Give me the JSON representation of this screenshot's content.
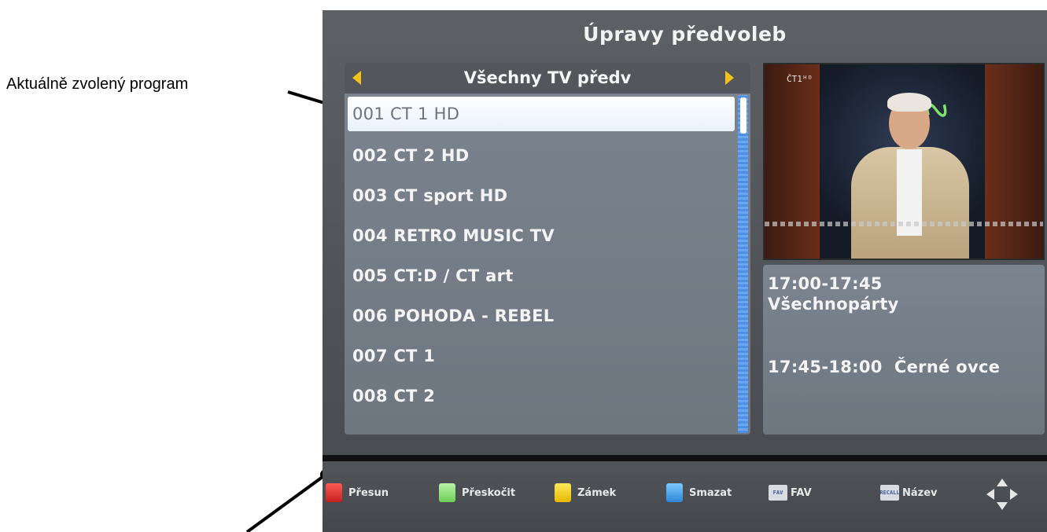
{
  "annotation": {
    "label": "Aktuálně zvolený program"
  },
  "screen": {
    "title": "Úpravy předvoleb",
    "list": {
      "header": "Všechny TV předv",
      "channels": [
        "001 CT 1 HD",
        "002 CT 2 HD",
        "003 CT sport HD",
        "004 RETRO MUSIC TV",
        "005 CT:D / CT art",
        "006 POHODA - REBEL",
        "007 CT 1",
        "008 CT 2"
      ],
      "selected_index": 0
    },
    "preview": {
      "logo": "ČT1ᴴᴰ"
    },
    "epg": {
      "now_time": "17:00-17:45",
      "now_title": "Všechnopárty",
      "next": "17:45-18:00  Černé ovce"
    },
    "footer": {
      "keys": [
        {
          "label": "Přesun",
          "color": "#e0302e"
        },
        {
          "label": "Přeskočit",
          "color": "#8ee07a"
        },
        {
          "label": "Zámek",
          "color": "#f4d21c"
        },
        {
          "label": "Smazat",
          "color": "#4aa8ee"
        }
      ],
      "fav_chip": "FAV",
      "fav_label": "FAV",
      "name_chip": "RECALL",
      "name_label": "Název",
      "nav_icon": "dpad-arrows-icon"
    }
  },
  "colors": {
    "accent_yellow": "#f3c21a",
    "scrollbar_blue": "#4c8fe3"
  }
}
